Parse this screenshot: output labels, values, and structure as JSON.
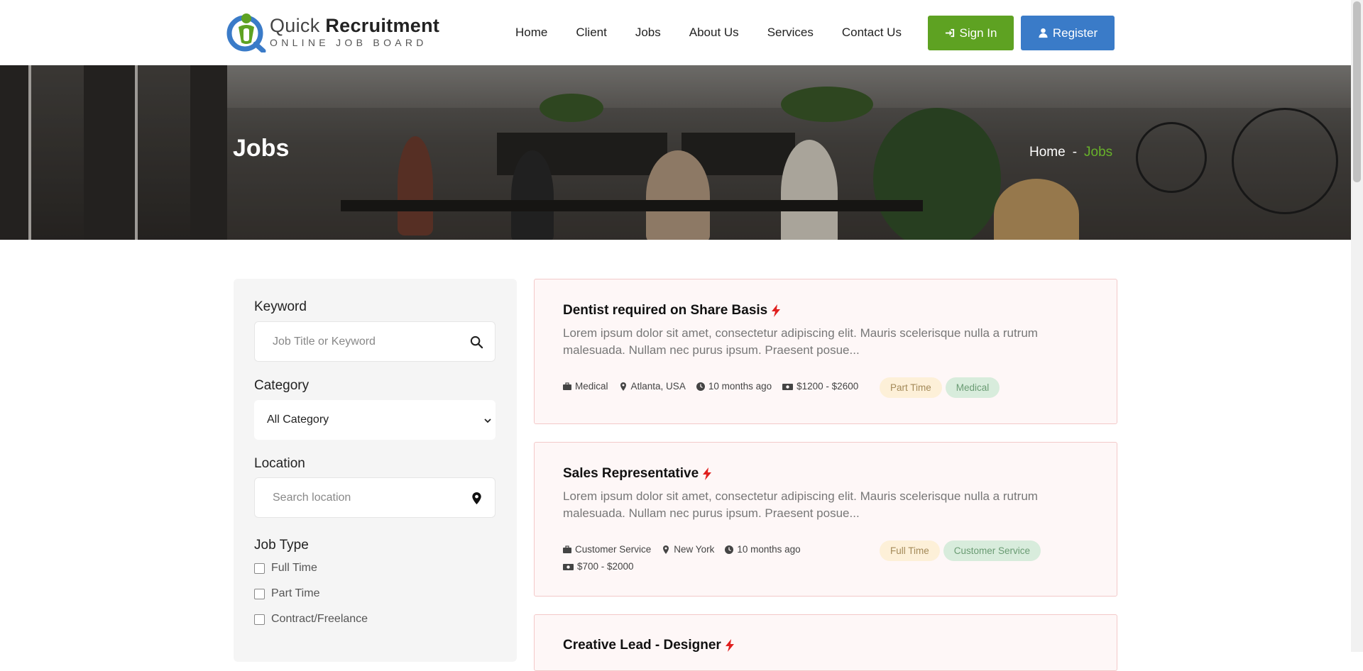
{
  "brand": {
    "name_light": "Quick",
    "name_bold": "Recruitment",
    "tagline": "ONLINE JOB BOARD",
    "colors": {
      "green": "#5ea222",
      "blue": "#3a7bc8"
    }
  },
  "nav": {
    "items": [
      {
        "label": "Home"
      },
      {
        "label": "Client"
      },
      {
        "label": "Jobs"
      },
      {
        "label": "About Us"
      },
      {
        "label": "Services"
      },
      {
        "label": "Contact Us"
      }
    ],
    "signin_label": "Sign In",
    "signin_icon": "sign-in-icon",
    "register_label": "Register",
    "register_icon": "user-icon"
  },
  "banner": {
    "title": "Jobs",
    "breadcrumb": {
      "home": "Home",
      "separator": "-",
      "current": "Jobs"
    }
  },
  "filters": {
    "keyword": {
      "label": "Keyword",
      "placeholder": "Job Title or Keyword",
      "icon": "search-icon"
    },
    "category": {
      "label": "Category",
      "selected": "All Category"
    },
    "location": {
      "label": "Location",
      "placeholder": "Search location",
      "icon": "map-pin-icon"
    },
    "job_type": {
      "label": "Job Type",
      "options": [
        {
          "label": "Full Time",
          "checked": false
        },
        {
          "label": "Part Time",
          "checked": false
        },
        {
          "label": "Contract/Freelance",
          "checked": false
        }
      ]
    }
  },
  "jobs": [
    {
      "title": "Dentist required on Share Basis",
      "description": "Lorem ipsum dolor sit amet, consectetur adipiscing elit. Mauris scelerisque nulla a rutrum malesuada. Nullam nec purus ipsum. Praesent posue...",
      "category": "Medical",
      "location": "Atlanta, USA",
      "posted": "10 months ago",
      "salary": "$1200 - $2600",
      "type_tag": "Part Time",
      "category_tag": "Medical"
    },
    {
      "title": "Sales Representative",
      "description": "Lorem ipsum dolor sit amet, consectetur adipiscing elit. Mauris scelerisque nulla a rutrum malesuada. Nullam nec purus ipsum. Praesent posue...",
      "category": "Customer Service",
      "location": "New York",
      "posted": "10 months ago",
      "salary": "$700 - $2000",
      "type_tag": "Full Time",
      "category_tag": "Customer Service"
    },
    {
      "title": "Creative Lead - Designer"
    }
  ]
}
